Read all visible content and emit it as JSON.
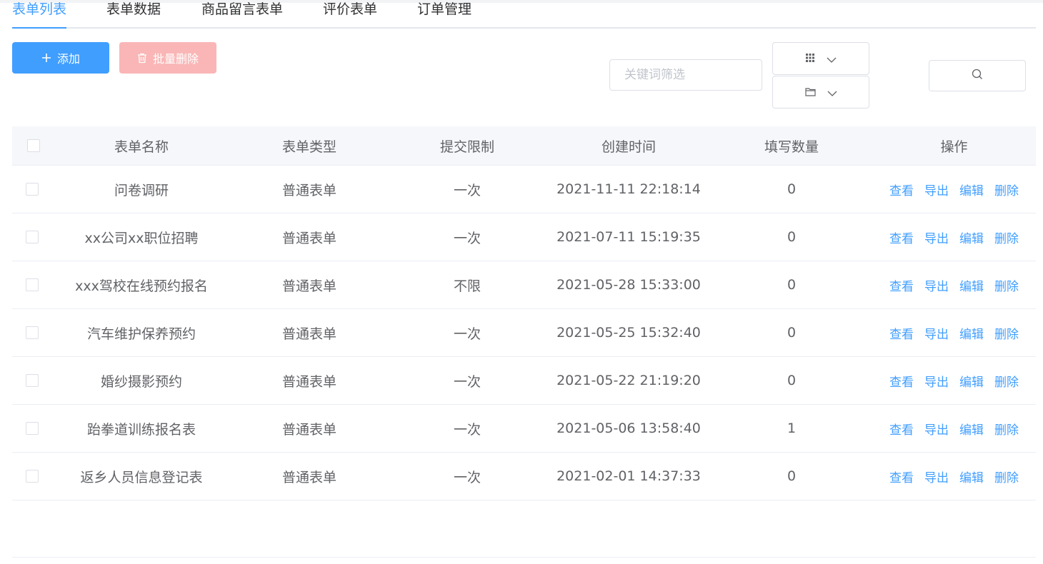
{
  "tabs": [
    "表单列表",
    "表单数据",
    "商品留言表单",
    "评价表单",
    "订单管理"
  ],
  "toolbar": {
    "add_label": "添加",
    "batch_delete_label": "批量删除"
  },
  "filter": {
    "keyword_placeholder": "关键词筛选",
    "keyword_value": ""
  },
  "icons": {
    "add": "plus-icon",
    "batch_delete": "trash-icon",
    "view_mode": "grid-icon",
    "folder": "folder-icon",
    "dropdown": "chevron-down-icon",
    "search": "search-icon"
  },
  "colors": {
    "primary": "#409eff",
    "danger_disabled": "#fab6b6",
    "header_bg": "#f5f7fa"
  },
  "table": {
    "columns": [
      "表单名称",
      "表单类型",
      "提交限制",
      "创建时间",
      "填写数量",
      "操作"
    ],
    "rows": [
      {
        "name": "问卷调研",
        "type": "普通表单",
        "limit": "一次",
        "created": "2021-11-11 22:18:14",
        "count": "0"
      },
      {
        "name": "xx公司xx职位招聘",
        "type": "普通表单",
        "limit": "一次",
        "created": "2021-07-11 15:19:35",
        "count": "0"
      },
      {
        "name": "xxx驾校在线预约报名",
        "type": "普通表单",
        "limit": "不限",
        "created": "2021-05-28 15:33:00",
        "count": "0"
      },
      {
        "name": "汽车维护保养预约",
        "type": "普通表单",
        "limit": "一次",
        "created": "2021-05-25 15:32:40",
        "count": "0"
      },
      {
        "name": "婚纱摄影预约",
        "type": "普通表单",
        "limit": "一次",
        "created": "2021-05-22 21:19:20",
        "count": "0"
      },
      {
        "name": "跆拳道训练报名表",
        "type": "普通表单",
        "limit": "一次",
        "created": "2021-05-06 13:58:40",
        "count": "1"
      },
      {
        "name": "返乡人员信息登记表",
        "type": "普通表单",
        "limit": "一次",
        "created": "2021-02-01 14:37:33",
        "count": "0"
      }
    ],
    "actions": [
      "查看",
      "导出",
      "编辑",
      "删除"
    ]
  }
}
